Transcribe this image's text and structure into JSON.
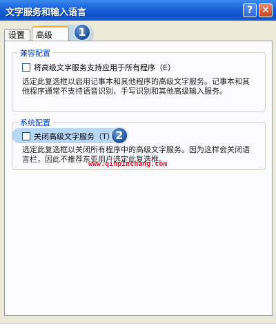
{
  "window": {
    "title": "文字服务和输入语言",
    "help_glyph": "?",
    "close_glyph": "✕"
  },
  "tabs": [
    {
      "label": "设置",
      "active": false
    },
    {
      "label": "高级",
      "active": true
    }
  ],
  "compat_group": {
    "legend": "兼容配置",
    "checkbox_label": "将高级文字服务支持应用于所有程序（E）",
    "checked": false,
    "description": "选定此复选框以启用记事本和其他程序的高级文字服务。记事本和其他程序通常不支持语音识别、手写识别和其他高级输入服务。"
  },
  "system_group": {
    "legend": "系统配置",
    "checkbox_label": "关闭高级文字服务（T）",
    "checked": false,
    "description": "选定此复选框以关闭所有程序中的高级文字服务。因为这样会关闭语言栏，因此不推荐东亚用户选定此复选框。"
  },
  "annotations": {
    "step1": "1",
    "step2": "2",
    "accent": "#1b4f9a"
  },
  "watermark": "www.qinpinchang.com"
}
